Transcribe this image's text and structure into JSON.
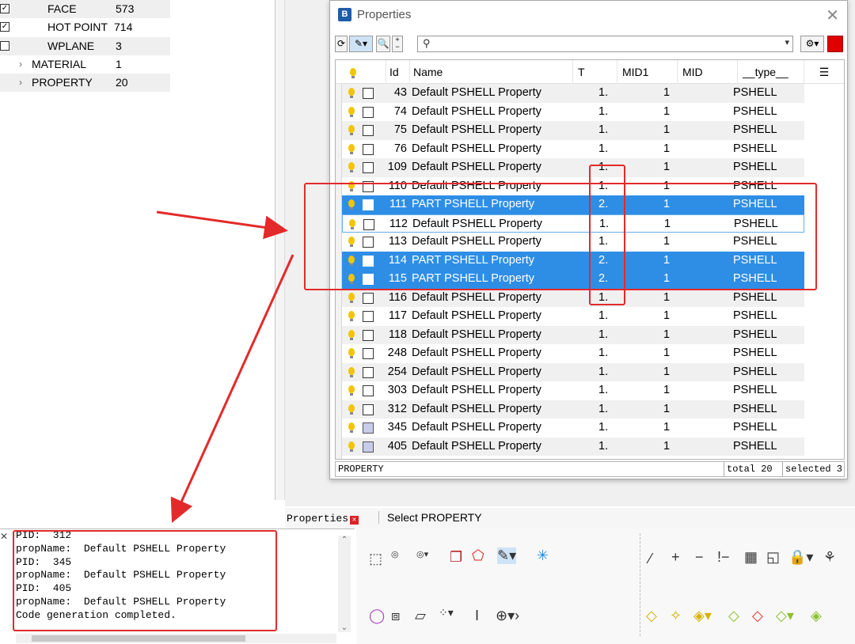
{
  "tree": {
    "rows": [
      {
        "check": true,
        "label": "FACE",
        "count": "573"
      },
      {
        "check": true,
        "label": "HOT POINT",
        "count": "714"
      },
      {
        "check": false,
        "label": "WPLANE",
        "count": "3"
      },
      {
        "expand": true,
        "label": "MATERIAL",
        "count": "1"
      },
      {
        "expand": true,
        "label": "PROPERTY",
        "count": "20"
      }
    ]
  },
  "dialog": {
    "title": "Properties",
    "close_glyph": "✕",
    "search_placeholder": "",
    "columns": [
      "Id",
      "Name",
      "T",
      "MID1",
      "MID",
      "__type__"
    ],
    "rows": [
      {
        "id": "43",
        "name": "Default PSHELL Property",
        "t": "1.",
        "mid1": "1",
        "type": "PSHELL",
        "state": "alt"
      },
      {
        "id": "74",
        "name": "Default PSHELL Property",
        "t": "1.",
        "mid1": "1",
        "type": "PSHELL",
        "state": ""
      },
      {
        "id": "75",
        "name": "Default PSHELL Property",
        "t": "1.",
        "mid1": "1",
        "type": "PSHELL",
        "state": "alt"
      },
      {
        "id": "76",
        "name": "Default PSHELL Property",
        "t": "1.",
        "mid1": "1",
        "type": "PSHELL",
        "state": ""
      },
      {
        "id": "109",
        "name": "Default PSHELL Property",
        "t": "1.",
        "mid1": "1",
        "type": "PSHELL",
        "state": "alt"
      },
      {
        "id": "110",
        "name": "Default PSHELL Property",
        "t": "1.",
        "mid1": "1",
        "type": "PSHELL",
        "state": ""
      },
      {
        "id": "111",
        "name": "PART PSHELL Property",
        "t": "2.",
        "mid1": "1",
        "type": "PSHELL",
        "state": "sel"
      },
      {
        "id": "112",
        "name": "Default PSHELL Property",
        "t": "1.",
        "mid1": "1",
        "type": "PSHELL",
        "state": "focus"
      },
      {
        "id": "113",
        "name": "Default PSHELL Property",
        "t": "1.",
        "mid1": "1",
        "type": "PSHELL",
        "state": ""
      },
      {
        "id": "114",
        "name": "PART PSHELL Property",
        "t": "2.",
        "mid1": "1",
        "type": "PSHELL",
        "state": "sel"
      },
      {
        "id": "115",
        "name": "PART PSHELL Property",
        "t": "2.",
        "mid1": "1",
        "type": "PSHELL",
        "state": "sel"
      },
      {
        "id": "116",
        "name": "Default PSHELL Property",
        "t": "1.",
        "mid1": "1",
        "type": "PSHELL",
        "state": "alt"
      },
      {
        "id": "117",
        "name": "Default PSHELL Property",
        "t": "1.",
        "mid1": "1",
        "type": "PSHELL",
        "state": ""
      },
      {
        "id": "118",
        "name": "Default PSHELL Property",
        "t": "1.",
        "mid1": "1",
        "type": "PSHELL",
        "state": "alt"
      },
      {
        "id": "248",
        "name": "Default PSHELL Property",
        "t": "1.",
        "mid1": "1",
        "type": "PSHELL",
        "state": ""
      },
      {
        "id": "254",
        "name": "Default PSHELL Property",
        "t": "1.",
        "mid1": "1",
        "type": "PSHELL",
        "state": "alt"
      },
      {
        "id": "303",
        "name": "Default PSHELL Property",
        "t": "1.",
        "mid1": "1",
        "type": "PSHELL",
        "state": ""
      },
      {
        "id": "312",
        "name": "Default PSHELL Property",
        "t": "1.",
        "mid1": "1",
        "type": "PSHELL",
        "state": "alt"
      },
      {
        "id": "345",
        "name": "Default PSHELL Property",
        "t": "1.",
        "mid1": "1",
        "type": "PSHELL",
        "state": "",
        "filled": true
      },
      {
        "id": "405",
        "name": "Default PSHELL Property",
        "t": "1.",
        "mid1": "1",
        "type": "PSHELL",
        "state": "alt",
        "filled": true
      }
    ],
    "footer": {
      "entity": "PROPERTY",
      "total": "total 20",
      "selected": "selected 3"
    }
  },
  "tabs": {
    "properties": "Properties",
    "select": "Select PROPERTY"
  },
  "console": {
    "lines": [
      "PID:  312",
      "propName:  Default PSHELL Property",
      "PID:  345",
      "propName:  Default PSHELL Property",
      "PID:  405",
      "propName:  Default PSHELL Property",
      "Code generation completed."
    ]
  },
  "colors": {
    "selection": "#2e8ee6",
    "annotation": "#e32a2a",
    "bulb": "#f2c500"
  }
}
